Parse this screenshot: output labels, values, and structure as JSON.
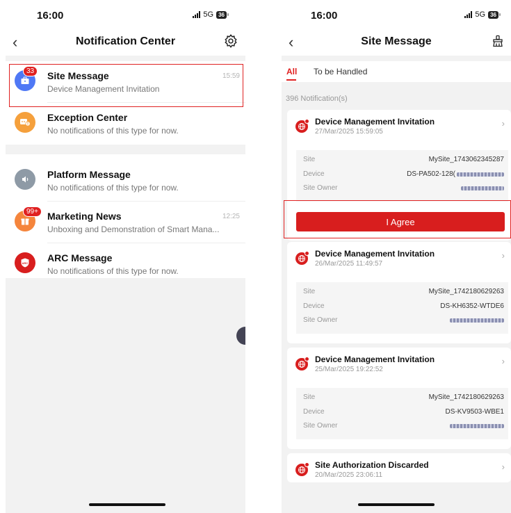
{
  "left": {
    "status_time": "16:00",
    "network": "5G",
    "battery": "36",
    "title": "Notification Center",
    "items": [
      {
        "title": "Site Message",
        "subtitle": "Device Management Invitation",
        "time": "15:59",
        "badge": "33",
        "color": "#4f78f5"
      },
      {
        "title": "Exception Center",
        "subtitle": "No notifications of this type for now.",
        "time": "",
        "badge": "",
        "color": "#f5a03c"
      },
      {
        "title": "Platform Message",
        "subtitle": "No notifications of this type for now.",
        "time": "",
        "badge": "",
        "color": "#8e9aa6"
      },
      {
        "title": "Marketing News",
        "subtitle": "Unboxing and Demonstration of Smart Mana...",
        "time": "12:25",
        "badge": "99+",
        "color": "#f5853c"
      },
      {
        "title": "ARC Message",
        "subtitle": "No notifications of this type for now.",
        "time": "",
        "badge": "",
        "color": "#d81e1e",
        "icon_text": "ARC"
      }
    ]
  },
  "right": {
    "status_time": "16:00",
    "network": "5G",
    "battery": "36",
    "title": "Site Message",
    "tabs": [
      "All",
      "To be Handled"
    ],
    "count": "396 Notification(s)",
    "agree_label": "I Agree",
    "labels": {
      "site": "Site",
      "device": "Device",
      "owner": "Site Owner"
    },
    "messages": [
      {
        "title": "Device Management Invitation",
        "date": "27/Mar/2025 15:59:05",
        "site": "MySite_1743062345287",
        "device": "DS-PA502-128("
      },
      {
        "title": "Device Management Invitation",
        "date": "26/Mar/2025 11:49:57",
        "site": "MySite_1742180629263",
        "device": "DS-KH6352-WTDE6"
      },
      {
        "title": "Device Management Invitation",
        "date": "25/Mar/2025 19:22:52",
        "site": "MySite_1742180629263",
        "device": "DS-KV9503-WBE1"
      },
      {
        "title": "Site Authorization Discarded",
        "date": "20/Mar/2025 23:06:11"
      }
    ]
  }
}
